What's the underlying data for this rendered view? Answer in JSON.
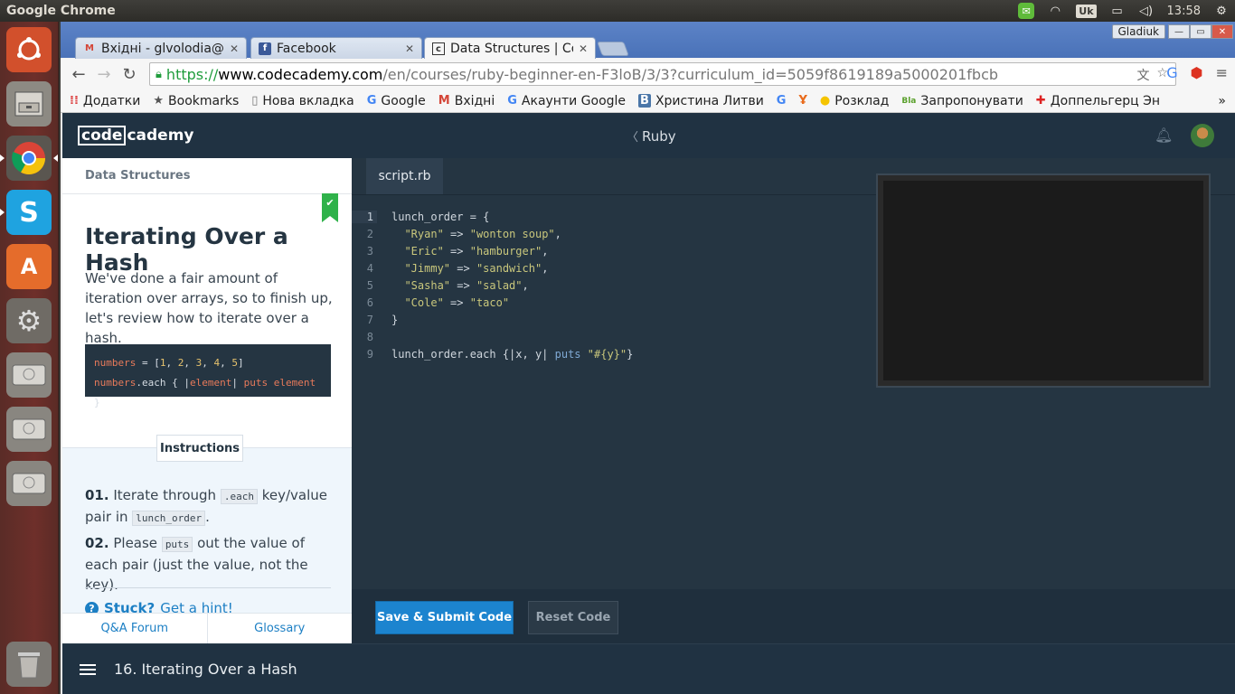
{
  "os": {
    "app_title": "Google Chrome",
    "keyboard_layout": "Uk",
    "time": "13:58"
  },
  "launcher": {
    "items": [
      "ubuntu-home",
      "files",
      "chrome",
      "skype",
      "software-center",
      "system-settings",
      "disk",
      "disk",
      "disk",
      "trash"
    ]
  },
  "browser": {
    "user": "Gladiuk",
    "tabs": [
      {
        "label": "Вхідні - glvolodia@g",
        "favicon": "M",
        "active": false
      },
      {
        "label": "Facebook",
        "favicon": "f",
        "active": false
      },
      {
        "label": "Data Structures | Co",
        "favicon": "c",
        "active": true
      }
    ],
    "url": {
      "scheme": "https://",
      "host": "www.codecademy.com",
      "path": "/en/courses/ruby-beginner-en-F3loB/3/3?curriculum_id=5059f8619189a5000201fbcb"
    },
    "bookmarks": [
      {
        "label": "Додатки",
        "icon": "apps-icon"
      },
      {
        "label": "Bookmarks",
        "icon": "star-icon"
      },
      {
        "label": "Нова вкладка",
        "icon": "page-icon"
      },
      {
        "label": "Google",
        "icon": "google-icon"
      },
      {
        "label": "Вхідні",
        "icon": "gmail-icon"
      },
      {
        "label": "Акаунти Google",
        "icon": "google-icon"
      },
      {
        "label": "Христина Литви",
        "icon": "vk-icon"
      },
      {
        "label": "",
        "icon": "google-icon"
      },
      {
        "label": "",
        "icon": "ya-icon"
      },
      {
        "label": "Розклад",
        "icon": "dot-icon"
      },
      {
        "label": "Запропонувати",
        "icon": "blabla-icon"
      },
      {
        "label": "Доппельгерц Эн",
        "icon": "plus-icon"
      }
    ],
    "bookmarks_more": "»"
  },
  "codecademy": {
    "logo_left": "code",
    "logo_right": "cademy",
    "course": "Ruby",
    "lesson_section": "Data Structures",
    "lesson_title": "Iterating Over a Hash",
    "lesson_intro": "We've done a fair amount of iteration over arrays, so to finish up, let's review how to iterate over a hash.",
    "sample": {
      "line1_var": "numbers",
      "line1_rest": " = [",
      "numbers": [
        "1",
        "2",
        "3",
        "4",
        "5"
      ],
      "line2_var": "numbers",
      "line2_method": ".each",
      "line2_open": " { |",
      "line2_param": "element",
      "line2_mid": "| ",
      "line2_puts": "puts element",
      "line2_close": " }"
    },
    "instructions_label": "Instructions",
    "instructions": [
      {
        "num": "01.",
        "before": "Iterate through ",
        "code1": ".each",
        "middle": " key/value pair in ",
        "code2": "lunch_order",
        "after": "."
      },
      {
        "num": "02.",
        "before": "Please ",
        "code1": "puts",
        "after": " out the value of each pair (just the value, not the key)."
      }
    ],
    "hint_stuck": "Stuck?",
    "hint_link": "Get a hint!",
    "footer_links": [
      "Q&A Forum",
      "Glossary"
    ],
    "editor_tab": "script.rb",
    "code": [
      {
        "n": "1",
        "segments": [
          {
            "t": "lunch_order = {",
            "c": ""
          }
        ]
      },
      {
        "n": "2",
        "segments": [
          {
            "t": "  ",
            "c": ""
          },
          {
            "t": "\"Ryan\"",
            "c": "str"
          },
          {
            "t": " => ",
            "c": ""
          },
          {
            "t": "\"wonton soup\"",
            "c": "str"
          },
          {
            "t": ",",
            "c": ""
          }
        ]
      },
      {
        "n": "3",
        "segments": [
          {
            "t": "  ",
            "c": ""
          },
          {
            "t": "\"Eric\"",
            "c": "str"
          },
          {
            "t": " => ",
            "c": ""
          },
          {
            "t": "\"hamburger\"",
            "c": "str"
          },
          {
            "t": ",",
            "c": ""
          }
        ]
      },
      {
        "n": "4",
        "segments": [
          {
            "t": "  ",
            "c": ""
          },
          {
            "t": "\"Jimmy\"",
            "c": "str"
          },
          {
            "t": " => ",
            "c": ""
          },
          {
            "t": "\"sandwich\"",
            "c": "str"
          },
          {
            "t": ",",
            "c": ""
          }
        ]
      },
      {
        "n": "5",
        "segments": [
          {
            "t": "  ",
            "c": ""
          },
          {
            "t": "\"Sasha\"",
            "c": "str"
          },
          {
            "t": " => ",
            "c": ""
          },
          {
            "t": "\"salad\"",
            "c": "str"
          },
          {
            "t": ",",
            "c": ""
          }
        ]
      },
      {
        "n": "6",
        "segments": [
          {
            "t": "  ",
            "c": ""
          },
          {
            "t": "\"Cole\"",
            "c": "str"
          },
          {
            "t": " => ",
            "c": ""
          },
          {
            "t": "\"taco\"",
            "c": "str"
          }
        ]
      },
      {
        "n": "7",
        "segments": [
          {
            "t": "}",
            "c": ""
          }
        ]
      },
      {
        "n": "8",
        "segments": [
          {
            "t": "",
            "c": ""
          }
        ]
      },
      {
        "n": "9",
        "segments": [
          {
            "t": "lunch_order.each {|x, y| ",
            "c": ""
          },
          {
            "t": "puts",
            "c": "kw"
          },
          {
            "t": " ",
            "c": ""
          },
          {
            "t": "\"#{y}\"",
            "c": "str"
          },
          {
            "t": "}",
            "c": ""
          }
        ]
      }
    ],
    "submit_label": "Save & Submit Code",
    "reset_label": "Reset Code",
    "footer_title": "16. Iterating Over a Hash"
  },
  "colors": {
    "accent": "#1c84cf",
    "check": "#2fb24a",
    "app_bg": "#253542"
  }
}
